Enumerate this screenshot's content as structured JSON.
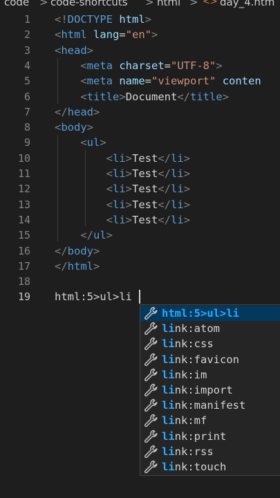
{
  "breadcrumb": {
    "parts": [
      "code",
      "code-shortcuts",
      "html",
      "day_4.htm"
    ],
    "separator": ">",
    "file_icon": "<>"
  },
  "editor": {
    "active_line": 19,
    "lines": [
      {
        "num": "1",
        "tokens": [
          {
            "t": "<!",
            "c": "tb"
          },
          {
            "t": "DOCTYPE",
            "c": "tn"
          },
          {
            "t": " ",
            "c": "tx"
          },
          {
            "t": "html",
            "c": "at"
          },
          {
            "t": ">",
            "c": "tb"
          }
        ]
      },
      {
        "num": "2",
        "tokens": [
          {
            "t": "<",
            "c": "tb"
          },
          {
            "t": "html",
            "c": "tn"
          },
          {
            "t": " ",
            "c": "tx"
          },
          {
            "t": "lang",
            "c": "at"
          },
          {
            "t": "=",
            "c": "tx"
          },
          {
            "t": "\"en\"",
            "c": "sv"
          },
          {
            "t": ">",
            "c": "tb"
          }
        ]
      },
      {
        "num": "3",
        "tokens": [
          {
            "t": "<",
            "c": "tb"
          },
          {
            "t": "head",
            "c": "tn"
          },
          {
            "t": ">",
            "c": "tb"
          }
        ]
      },
      {
        "num": "4",
        "tokens": [
          {
            "t": "    ",
            "c": "tx"
          },
          {
            "t": "<",
            "c": "tb"
          },
          {
            "t": "meta",
            "c": "tn"
          },
          {
            "t": " ",
            "c": "tx"
          },
          {
            "t": "charset",
            "c": "at"
          },
          {
            "t": "=",
            "c": "tx"
          },
          {
            "t": "\"UTF-8\"",
            "c": "sv"
          },
          {
            "t": ">",
            "c": "tb"
          }
        ]
      },
      {
        "num": "5",
        "tokens": [
          {
            "t": "    ",
            "c": "tx"
          },
          {
            "t": "<",
            "c": "tb"
          },
          {
            "t": "meta",
            "c": "tn"
          },
          {
            "t": " ",
            "c": "tx"
          },
          {
            "t": "name",
            "c": "at"
          },
          {
            "t": "=",
            "c": "tx"
          },
          {
            "t": "\"viewport\"",
            "c": "sv"
          },
          {
            "t": " ",
            "c": "tx"
          },
          {
            "t": "conten",
            "c": "at"
          }
        ]
      },
      {
        "num": "6",
        "tokens": [
          {
            "t": "    ",
            "c": "tx"
          },
          {
            "t": "<",
            "c": "tb"
          },
          {
            "t": "title",
            "c": "tn"
          },
          {
            "t": ">",
            "c": "tb"
          },
          {
            "t": "Document",
            "c": "tx"
          },
          {
            "t": "</",
            "c": "tb"
          },
          {
            "t": "title",
            "c": "tn"
          },
          {
            "t": ">",
            "c": "tb"
          }
        ]
      },
      {
        "num": "7",
        "tokens": [
          {
            "t": "</",
            "c": "tb"
          },
          {
            "t": "head",
            "c": "tn"
          },
          {
            "t": ">",
            "c": "tb"
          }
        ]
      },
      {
        "num": "8",
        "tokens": [
          {
            "t": "<",
            "c": "tb"
          },
          {
            "t": "body",
            "c": "tn"
          },
          {
            "t": ">",
            "c": "tb"
          }
        ]
      },
      {
        "num": "9",
        "tokens": [
          {
            "t": "    ",
            "c": "tx"
          },
          {
            "t": "<",
            "c": "tb"
          },
          {
            "t": "ul",
            "c": "tn"
          },
          {
            "t": ">",
            "c": "tb"
          }
        ]
      },
      {
        "num": "10",
        "tokens": [
          {
            "t": "        ",
            "c": "tx"
          },
          {
            "t": "<",
            "c": "tb"
          },
          {
            "t": "li",
            "c": "tn"
          },
          {
            "t": ">",
            "c": "tb"
          },
          {
            "t": "Test",
            "c": "tx"
          },
          {
            "t": "</",
            "c": "tb"
          },
          {
            "t": "li",
            "c": "tn"
          },
          {
            "t": ">",
            "c": "tb"
          }
        ]
      },
      {
        "num": "11",
        "tokens": [
          {
            "t": "        ",
            "c": "tx"
          },
          {
            "t": "<",
            "c": "tb"
          },
          {
            "t": "li",
            "c": "tn"
          },
          {
            "t": ">",
            "c": "tb"
          },
          {
            "t": "Test",
            "c": "tx"
          },
          {
            "t": "</",
            "c": "tb"
          },
          {
            "t": "li",
            "c": "tn"
          },
          {
            "t": ">",
            "c": "tb"
          }
        ]
      },
      {
        "num": "12",
        "tokens": [
          {
            "t": "        ",
            "c": "tx"
          },
          {
            "t": "<",
            "c": "tb"
          },
          {
            "t": "li",
            "c": "tn"
          },
          {
            "t": ">",
            "c": "tb"
          },
          {
            "t": "Test",
            "c": "tx"
          },
          {
            "t": "</",
            "c": "tb"
          },
          {
            "t": "li",
            "c": "tn"
          },
          {
            "t": ">",
            "c": "tb"
          }
        ]
      },
      {
        "num": "13",
        "tokens": [
          {
            "t": "        ",
            "c": "tx"
          },
          {
            "t": "<",
            "c": "tb"
          },
          {
            "t": "li",
            "c": "tn"
          },
          {
            "t": ">",
            "c": "tb"
          },
          {
            "t": "Test",
            "c": "tx"
          },
          {
            "t": "</",
            "c": "tb"
          },
          {
            "t": "li",
            "c": "tn"
          },
          {
            "t": ">",
            "c": "tb"
          }
        ]
      },
      {
        "num": "14",
        "tokens": [
          {
            "t": "        ",
            "c": "tx"
          },
          {
            "t": "<",
            "c": "tb"
          },
          {
            "t": "li",
            "c": "tn"
          },
          {
            "t": ">",
            "c": "tb"
          },
          {
            "t": "Test",
            "c": "tx"
          },
          {
            "t": "</",
            "c": "tb"
          },
          {
            "t": "li",
            "c": "tn"
          },
          {
            "t": ">",
            "c": "tb"
          }
        ]
      },
      {
        "num": "15",
        "tokens": [
          {
            "t": "    ",
            "c": "tx"
          },
          {
            "t": "</",
            "c": "tb"
          },
          {
            "t": "ul",
            "c": "tn"
          },
          {
            "t": ">",
            "c": "tb"
          }
        ]
      },
      {
        "num": "16",
        "tokens": [
          {
            "t": "</",
            "c": "tb"
          },
          {
            "t": "body",
            "c": "tn"
          },
          {
            "t": ">",
            "c": "tb"
          }
        ]
      },
      {
        "num": "17",
        "tokens": [
          {
            "t": "</",
            "c": "tb"
          },
          {
            "t": "html",
            "c": "tn"
          },
          {
            "t": ">",
            "c": "tb"
          }
        ]
      },
      {
        "num": "18",
        "tokens": []
      },
      {
        "num": "19",
        "tokens": [
          {
            "t": "html:5>ul>li",
            "c": "tx"
          }
        ]
      }
    ]
  },
  "suggestions": {
    "selected_index": 0,
    "icon": "wrench-icon",
    "items": [
      {
        "match": "html:5>ul>li",
        "rest": ""
      },
      {
        "match": "li",
        "rest": "nk:atom"
      },
      {
        "match": "li",
        "rest": "nk:css"
      },
      {
        "match": "li",
        "rest": "nk:favicon"
      },
      {
        "match": "li",
        "rest": "nk:im"
      },
      {
        "match": "li",
        "rest": "nk:import"
      },
      {
        "match": "li",
        "rest": "nk:manifest"
      },
      {
        "match": "li",
        "rest": "nk:mf"
      },
      {
        "match": "li",
        "rest": "nk:print"
      },
      {
        "match": "li",
        "rest": "nk:rss"
      },
      {
        "match": "li",
        "rest": "nk:touch"
      }
    ]
  },
  "colors": {
    "background": "#1e1e1e",
    "tag_name": "#569cd6",
    "attribute": "#9cdcfe",
    "string": "#ce9178",
    "bracket": "#808080",
    "match_highlight": "#2aaaff",
    "selected_row": "#04395e"
  }
}
